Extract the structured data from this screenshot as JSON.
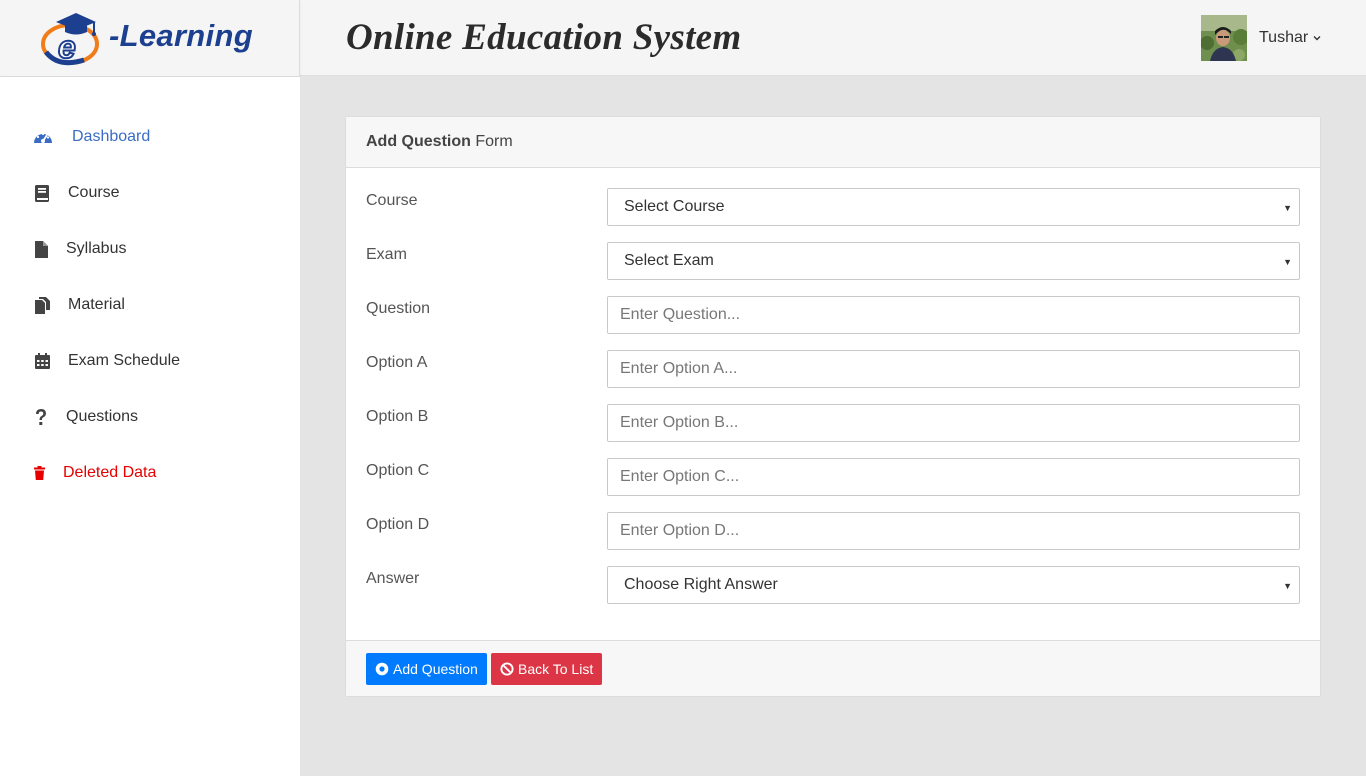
{
  "header": {
    "logo_text": "-Learning",
    "logo_letter": "e",
    "title": "Online Education System",
    "user_name": "Tushar"
  },
  "sidebar": {
    "items": [
      {
        "label": "Dashboard",
        "icon": "tachometer-icon",
        "state": "active"
      },
      {
        "label": "Course",
        "icon": "book-icon"
      },
      {
        "label": "Syllabus",
        "icon": "file-icon"
      },
      {
        "label": "Material",
        "icon": "copy-icon"
      },
      {
        "label": "Exam Schedule",
        "icon": "calendar-icon"
      },
      {
        "label": "Questions",
        "icon": "question-icon"
      },
      {
        "label": "Deleted Data",
        "icon": "trash-icon",
        "state": "danger"
      }
    ]
  },
  "form": {
    "title_bold": "Add Question",
    "title_rest": " Form",
    "fields": {
      "course": {
        "label": "Course",
        "value": "Select Course"
      },
      "exam": {
        "label": "Exam",
        "value": "Select Exam"
      },
      "question": {
        "label": "Question",
        "placeholder": "Enter Question..."
      },
      "option_a": {
        "label": "Option A",
        "placeholder": "Enter Option A..."
      },
      "option_b": {
        "label": "Option B",
        "placeholder": "Enter Option B..."
      },
      "option_c": {
        "label": "Option C",
        "placeholder": "Enter Option C..."
      },
      "option_d": {
        "label": "Option D",
        "placeholder": "Enter Option D..."
      },
      "answer": {
        "label": "Answer",
        "value": "Choose Right Answer"
      }
    },
    "buttons": {
      "add": "Add Question",
      "back": "Back To List"
    }
  },
  "colors": {
    "active_nav": "#3a6cc6",
    "danger": "#e60000",
    "primary_button": "#007bff",
    "danger_button": "#dc3545",
    "logo_blue": "#1d3f8f",
    "logo_orange": "#f07d1a"
  }
}
